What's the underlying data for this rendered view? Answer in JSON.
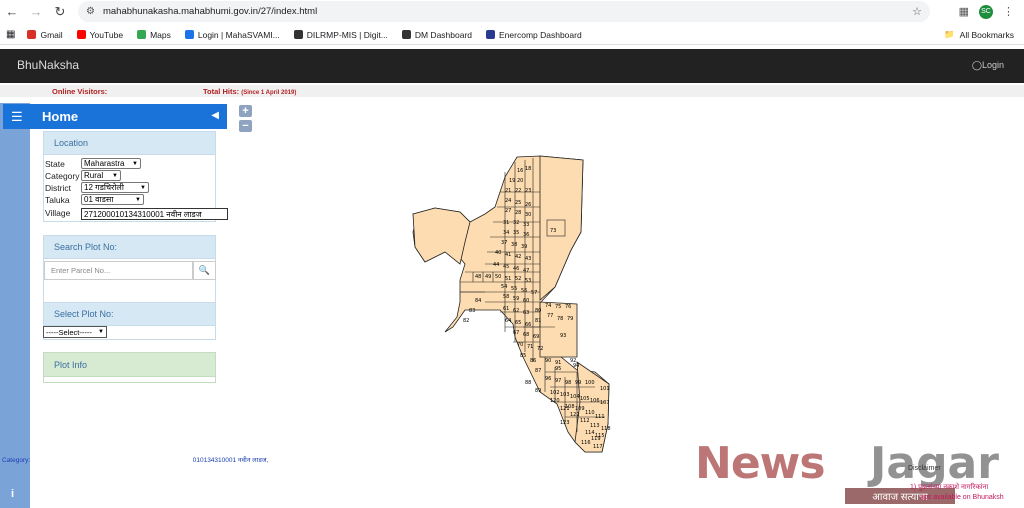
{
  "browser": {
    "url": "mahabhunakasha.mahabhumi.gov.in/27/index.html",
    "profile_initials": "SC",
    "bookmarks": [
      {
        "label": "Gmail",
        "color": "#d93025"
      },
      {
        "label": "YouTube",
        "color": "#ff0000"
      },
      {
        "label": "Maps",
        "color": "#34a853"
      },
      {
        "label": "Login | MahaSVAMI...",
        "color": "#1a73e8"
      },
      {
        "label": "DILRMP-MIS | Digit...",
        "color": "#333333"
      },
      {
        "label": "DM Dashboard",
        "color": "#333333"
      },
      {
        "label": "Enercomp Dashboard",
        "color": "#2a3b8f"
      }
    ],
    "all_bookmarks": "All Bookmarks"
  },
  "header": {
    "brand": "BhuNaksha",
    "login": "Login"
  },
  "hits": {
    "online_visitors": "Online Visitors:",
    "total_hits": "Total Hits:",
    "since": "(Since 1 April 2019)"
  },
  "sidebar": {
    "title": "Home",
    "location": {
      "heading": "Location",
      "fields": [
        {
          "label": "State",
          "value": "Maharastra"
        },
        {
          "label": "Category",
          "value": "Rural"
        },
        {
          "label": "District",
          "value": "12 गडचिरोली"
        },
        {
          "label": "Taluka",
          "value": "01 वाडसा"
        }
      ],
      "village_label": "Village",
      "village_value": "271200010134310001 नवीन लाडज"
    },
    "search": {
      "heading": "Search Plot No:",
      "placeholder": "Enter Parcel No..."
    },
    "select": {
      "heading": "Select Plot No:",
      "value": "-----Select-----"
    },
    "plot_info": {
      "heading": "Plot Info"
    }
  },
  "status_line": {
    "prefix": "Category:",
    "value": "010134310001 नवीन लाडज,"
  },
  "watermark": {
    "news": "News",
    "jagar": "Jagar",
    "tagline": "आवाज सत्याचा"
  },
  "disclaimer": {
    "title": "Disclaimer",
    "line1": "1) पुढलांच्या नकाशे नागरिकांना",
    "line2": "aps available on Bhunaksh"
  },
  "map_labels": [
    "16",
    "18",
    "20",
    "19",
    "21",
    "22",
    "23",
    "24",
    "25",
    "26",
    "27",
    "28",
    "30",
    "31",
    "32",
    "33",
    "34",
    "35",
    "36",
    "37",
    "38",
    "39",
    "40",
    "41",
    "42",
    "43",
    "44",
    "45",
    "46",
    "47",
    "48",
    "49",
    "50",
    "51",
    "52",
    "53",
    "54",
    "55",
    "56",
    "57",
    "58",
    "59",
    "60",
    "61",
    "62",
    "63",
    "64",
    "65",
    "66",
    "67",
    "68",
    "69",
    "70",
    "71",
    "72",
    "73",
    "74",
    "75",
    "76",
    "77",
    "78",
    "79",
    "80",
    "81",
    "82",
    "83",
    "84",
    "85",
    "86",
    "87",
    "88",
    "89",
    "90",
    "91",
    "92",
    "93",
    "94",
    "95",
    "96",
    "97",
    "98",
    "99",
    "100",
    "101",
    "102",
    "103",
    "104",
    "105",
    "106",
    "107",
    "108",
    "109",
    "110",
    "111",
    "112",
    "113",
    "114",
    "115",
    "116",
    "117",
    "118",
    "119",
    "120",
    "121",
    "122",
    "123"
  ]
}
